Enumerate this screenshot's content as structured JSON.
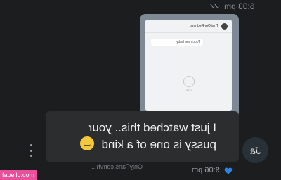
{
  "topbar": {
    "time": "6:03 pm"
  },
  "media": {
    "header": "Thai Ore Redhead",
    "message": "Touch me baby",
    "duration": "0:16"
  },
  "message": {
    "text": "I just watched this.. your pussy is one of a kind",
    "emoji_name": "drooling-face-emoji"
  },
  "avatar": {
    "initials": "Ja"
  },
  "footer": {
    "time": "9:06 pm",
    "watermark": "OnlyFans.com/h..."
  },
  "site": {
    "label": "fapello.com"
  }
}
